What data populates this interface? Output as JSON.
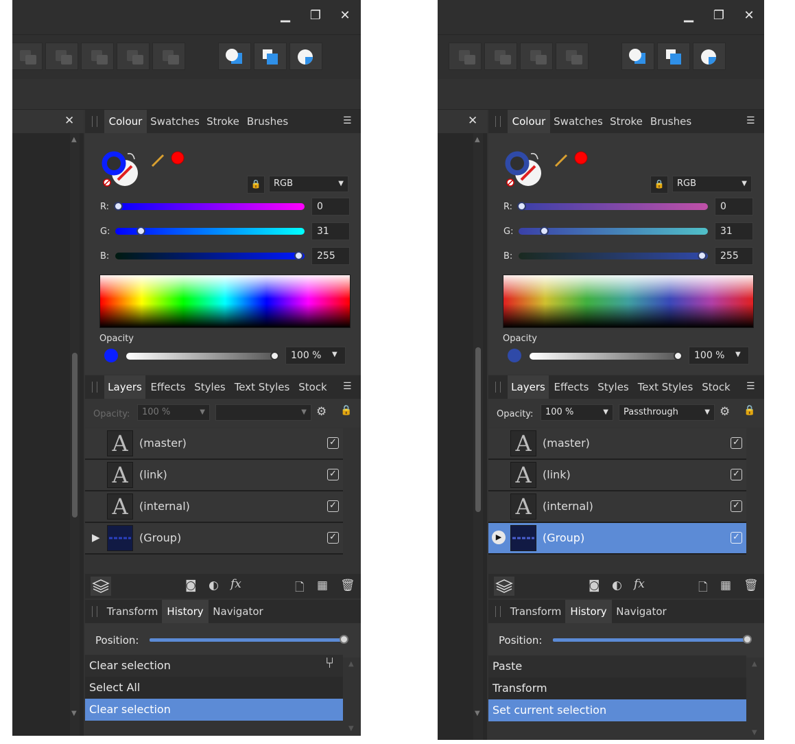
{
  "panels": [
    {
      "id": "before",
      "colour_tabs": [
        "Colour",
        "Swatches",
        "Stroke",
        "Brushes"
      ],
      "colour_model": "RGB",
      "rgb": [
        {
          "label": "R:",
          "value": "0",
          "fraction": 0.0
        },
        {
          "label": "G:",
          "value": "31",
          "fraction": 0.122
        },
        {
          "label": "B:",
          "value": "255",
          "fraction": 1.0
        }
      ],
      "opacity_label": "Opacity",
      "opacity_value": "100 %",
      "layers_tabs": [
        "Layers",
        "Effects",
        "Styles",
        "Text Styles",
        "Stock"
      ],
      "layer_opacity_label": "Opacity:",
      "layer_opacity_value": "100 %",
      "blend_mode": "",
      "layers": [
        {
          "name": "(master)",
          "kind": "text",
          "checked": true,
          "selected": false
        },
        {
          "name": "(link)",
          "kind": "text",
          "checked": true,
          "selected": false
        },
        {
          "name": "(internal)",
          "kind": "text",
          "checked": true,
          "selected": false
        },
        {
          "name": "(Group)",
          "kind": "group",
          "checked": true,
          "selected": false
        }
      ],
      "history_tabs": [
        "Transform",
        "History",
        "Navigator"
      ],
      "position_label": "Position:",
      "history": [
        "Clear selection",
        "Select All",
        "Clear selection"
      ],
      "history_selected": 2
    },
    {
      "id": "after",
      "colour_tabs": [
        "Colour",
        "Swatches",
        "Stroke",
        "Brushes"
      ],
      "colour_model": "RGB",
      "rgb": [
        {
          "label": "R:",
          "value": "0",
          "fraction": 0.0
        },
        {
          "label": "G:",
          "value": "31",
          "fraction": 0.122
        },
        {
          "label": "B:",
          "value": "255",
          "fraction": 1.0
        }
      ],
      "opacity_label": "Opacity",
      "opacity_value": "100 %",
      "layers_tabs": [
        "Layers",
        "Effects",
        "Styles",
        "Text Styles",
        "Stock"
      ],
      "layer_opacity_label": "Opacity:",
      "layer_opacity_value": "100 %",
      "blend_mode": "Passthrough",
      "layers": [
        {
          "name": "(master)",
          "kind": "text",
          "checked": true,
          "selected": false
        },
        {
          "name": "(link)",
          "kind": "text",
          "checked": true,
          "selected": false
        },
        {
          "name": "(internal)",
          "kind": "text",
          "checked": true,
          "selected": false
        },
        {
          "name": "(Group)",
          "kind": "group",
          "checked": true,
          "selected": true
        }
      ],
      "history_tabs": [
        "Transform",
        "History",
        "Navigator"
      ],
      "position_label": "Position:",
      "history": [
        "Paste",
        "Transform",
        "Set current selection"
      ],
      "history_selected": 2
    }
  ],
  "colors": {
    "accent_selection": "#5c8bd6",
    "fill_before": "#0a1fff",
    "fill_after": "#2f4aa8",
    "swatch_red": "#ff0000"
  },
  "icons": {
    "minimize": "minimize-icon",
    "restore": "restore-icon",
    "close": "close-icon",
    "layers": "layers-stack-icon",
    "mask": "mask-icon",
    "adjustment": "adjustment-icon",
    "fx": "fx-icon",
    "new_layer": "new-layer-icon",
    "new_pixel": "pixel-layer-icon",
    "delete": "trash-icon",
    "gear": "gear-icon",
    "lock": "lock-icon",
    "snapshot": "branch-icon"
  }
}
